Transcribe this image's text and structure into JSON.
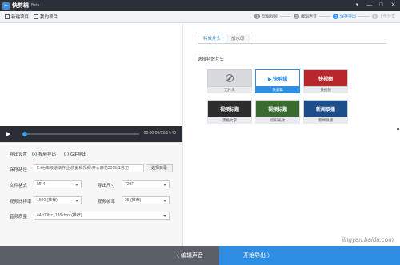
{
  "window": {
    "title": "快剪辑",
    "badge": "Beta",
    "logo_icon": "scissors-logo-icon"
  },
  "window_controls": [
    "▾",
    "—",
    "□",
    "✕"
  ],
  "toolbar": {
    "new_project": "新建项目",
    "my_projects": "我的项目"
  },
  "steps": [
    {
      "num": "1",
      "label": "剪辑视频",
      "state": "done"
    },
    {
      "num": "2",
      "label": "编辑声音",
      "state": "done"
    },
    {
      "num": "3",
      "label": "保存导出",
      "state": "active"
    },
    {
      "num": "4",
      "label": "上传分享",
      "state": "disabled"
    }
  ],
  "player": {
    "timecode": "00:00:00/13:14:40",
    "progress": 0
  },
  "export": {
    "section_label": "导出设置",
    "video_option": "视频导出",
    "gif_option": "GIF导出",
    "path_label": "保存路径",
    "path_value": "E:\\七年级道法作业\\快剪辑视频\\开心麻花2015江苏卫",
    "browse_button": "选择目录",
    "format_label": "文件格式",
    "format_value": "MP4",
    "size_label": "导出尺寸",
    "size_value": "720P",
    "bitrate_label": "视频比特率",
    "bitrate_value": "1500 (推荐)",
    "fps_label": "视频帧率",
    "fps_value": "25 (推荐)",
    "audio_label": "音频质量",
    "audio_value": "44100Hz, 128kbps (推荐)"
  },
  "right": {
    "tab_intro": "特效片头",
    "tab_watermark": "加水印",
    "section_title": "选择特效片头",
    "thumbs": [
      {
        "caption": "无片头",
        "art": "",
        "bg": "#d9dadd",
        "selected": false
      },
      {
        "caption": "快剪辑",
        "art": "▶ 快剪辑",
        "bg": "#ffffff",
        "selected": true
      },
      {
        "caption": "快视频",
        "art": "快视频",
        "bg": "#b8272c",
        "selected": false
      },
      {
        "caption": "黑色文字",
        "art": "视频标题",
        "bg": "#2c2c2c",
        "selected": false
      },
      {
        "caption": "炫彩光效",
        "art": "视频标题",
        "bg": "#3a6b2f",
        "selected": false
      },
      {
        "caption": "新闻联播",
        "art": "新闻联播",
        "bg": "#1c4e8a",
        "selected": false
      }
    ]
  },
  "bottom": {
    "back_button": "〈  编辑声音",
    "start_button": "开始导出  〉"
  },
  "watermark": "jingyan.baidu.com"
}
